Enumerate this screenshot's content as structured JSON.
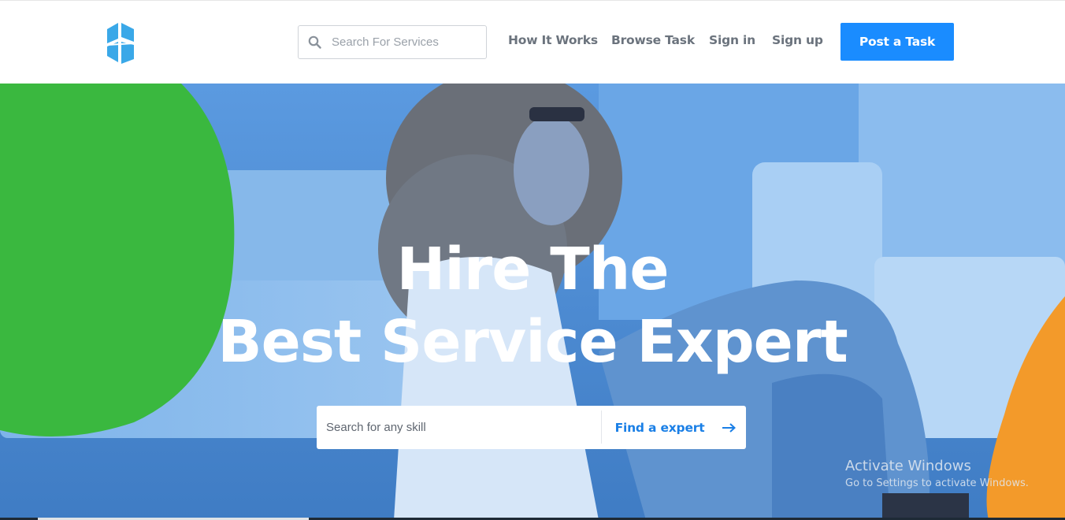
{
  "brand": {
    "logo_icon": "cube-logo-icon",
    "colors": {
      "logo": "#3aa8e8",
      "accent": "#1a8cff"
    }
  },
  "header": {
    "search": {
      "placeholder": "Search For Services",
      "icon": "search-icon"
    },
    "nav": [
      {
        "label": "How It Works"
      },
      {
        "label": "Browse Task"
      },
      {
        "label": "Sign in"
      },
      {
        "label": "Sign up"
      }
    ],
    "cta_label": "Post a Task"
  },
  "hero": {
    "title_line1": "Hire The",
    "title_line2": "Best Service Expert",
    "search": {
      "placeholder": "Search for any skill",
      "button_label": "Find a expert",
      "button_icon": "arrow-right-icon"
    },
    "colors": {
      "overlay": "#4f8fd6",
      "green_blob": "#3ab83f",
      "orange_blob": "#f39a2a"
    }
  },
  "system": {
    "watermark_title": "Activate Windows",
    "watermark_subtitle": "Go to Settings to activate Windows."
  }
}
